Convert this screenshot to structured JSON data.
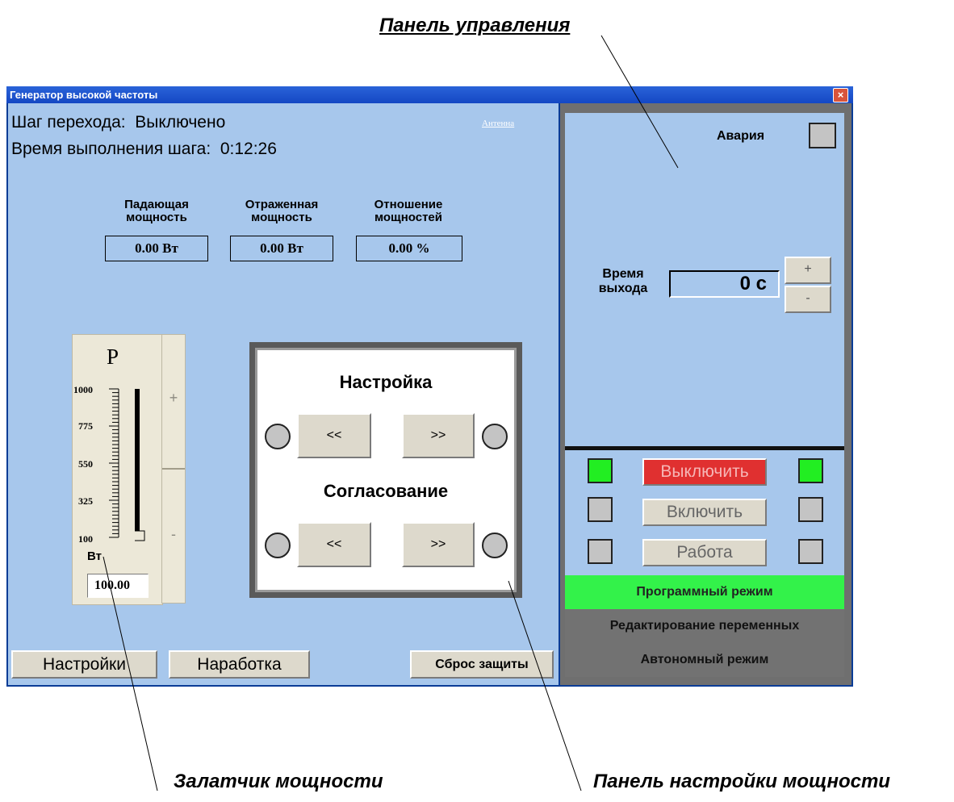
{
  "callouts": {
    "control_panel": "Панель управления",
    "power_setter": "Залатчик мощности",
    "power_tuning_panel": "Панель настройки мощности"
  },
  "window": {
    "title": "Генератор высокой частоты",
    "close": "×"
  },
  "status": {
    "step_label": "Шаг перехода:",
    "step_value": "Выключено",
    "time_label": "Время выполнения шага:",
    "time_value": "0:12:26",
    "link": "Антенна"
  },
  "measurements": [
    {
      "line1": "Падающая",
      "line2": "мощность",
      "value": "0.00 Вт"
    },
    {
      "line1": "Отраженная",
      "line2": "мощность",
      "value": "0.00 Вт"
    },
    {
      "line1": "Отношение",
      "line2": "мощностей",
      "value": "0.00 %"
    }
  ],
  "slider": {
    "symbol": "P",
    "ticks": [
      "1000",
      "775",
      "550",
      "325",
      "100"
    ],
    "unit": "Вт",
    "value": "100.00",
    "plus": "+",
    "minus": "-",
    "level_fraction": 0.0
  },
  "tuning": {
    "section1": "Настройка",
    "section2": "Согласование",
    "left": "<<",
    "right": ">>"
  },
  "bottom_buttons": {
    "settings": "Настройки",
    "runtime": "Наработка",
    "reset": "Сброс защиты"
  },
  "control": {
    "alarm": "Авария",
    "exit_time_line1": "Время",
    "exit_time_line2": "выхода",
    "exit_time_value": "0 с",
    "plus": "+",
    "minus": "-"
  },
  "power": {
    "off": "Выключить",
    "on": "Включить",
    "work": "Работа"
  },
  "modes": {
    "program": "Программный режим",
    "edit": "Редактирование переменных",
    "auto": "Автономный режим"
  },
  "colors": {
    "panel_bg": "#a7c7ec",
    "active_green": "#22ee22",
    "off_red": "#e03030",
    "mode_green": "#33f24a",
    "mode_gray": "#727272"
  }
}
